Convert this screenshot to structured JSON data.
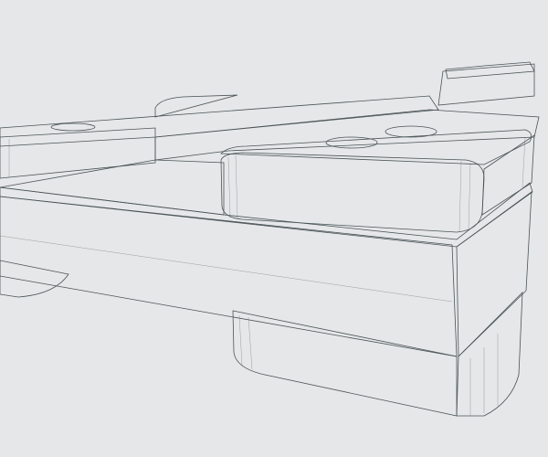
{
  "scene": {
    "subject": "3d-wireframe-render",
    "colors": {
      "background": "#e6e7e8",
      "face_light": "#b9c0c2",
      "face_mid": "#9aa3a6",
      "face_dark": "#7f898c",
      "edge": "#4a5457"
    }
  }
}
